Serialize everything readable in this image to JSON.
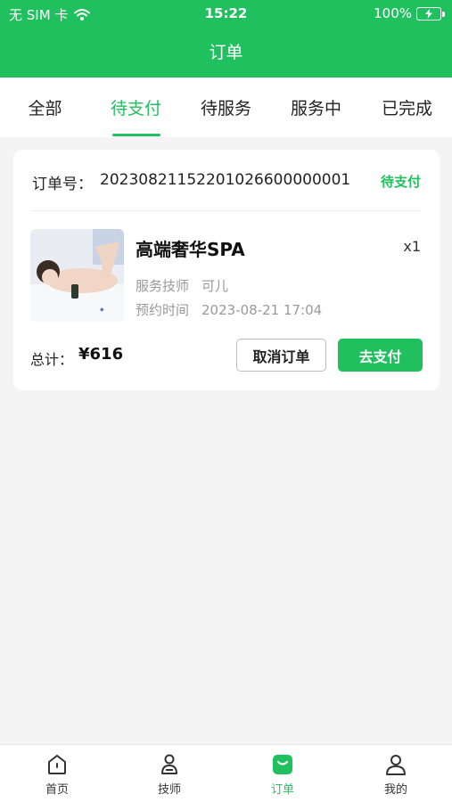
{
  "status_bar": {
    "carrier": "无 SIM 卡",
    "time": "15:22",
    "battery": "100%"
  },
  "header": {
    "title": "订单"
  },
  "tabs": [
    {
      "label": "全部",
      "active": false
    },
    {
      "label": "待支付",
      "active": true
    },
    {
      "label": "待服务",
      "active": false
    },
    {
      "label": "服务中",
      "active": false
    },
    {
      "label": "已完成",
      "active": false
    }
  ],
  "order": {
    "number_label": "订单号：",
    "number": "20230821152201026600000001",
    "status": "待支付",
    "service": {
      "name": "高端奢华SPA",
      "quantity": "x1",
      "technician_label": "服务技师",
      "technician": "可儿",
      "appointment_label": "预约时间",
      "appointment": "2023-08-21 17:04"
    },
    "total_label": "总计：",
    "total": "¥616",
    "cancel_label": "取消订单",
    "pay_label": "去支付"
  },
  "bottom_nav": [
    {
      "label": "首页",
      "icon": "home-icon",
      "active": false
    },
    {
      "label": "技师",
      "icon": "technician-icon",
      "active": false
    },
    {
      "label": "订单",
      "icon": "orders-icon",
      "active": true
    },
    {
      "label": "我的",
      "icon": "profile-icon",
      "active": false
    }
  ],
  "colors": {
    "brand": "#21c05f",
    "background": "#f4f4f4"
  }
}
